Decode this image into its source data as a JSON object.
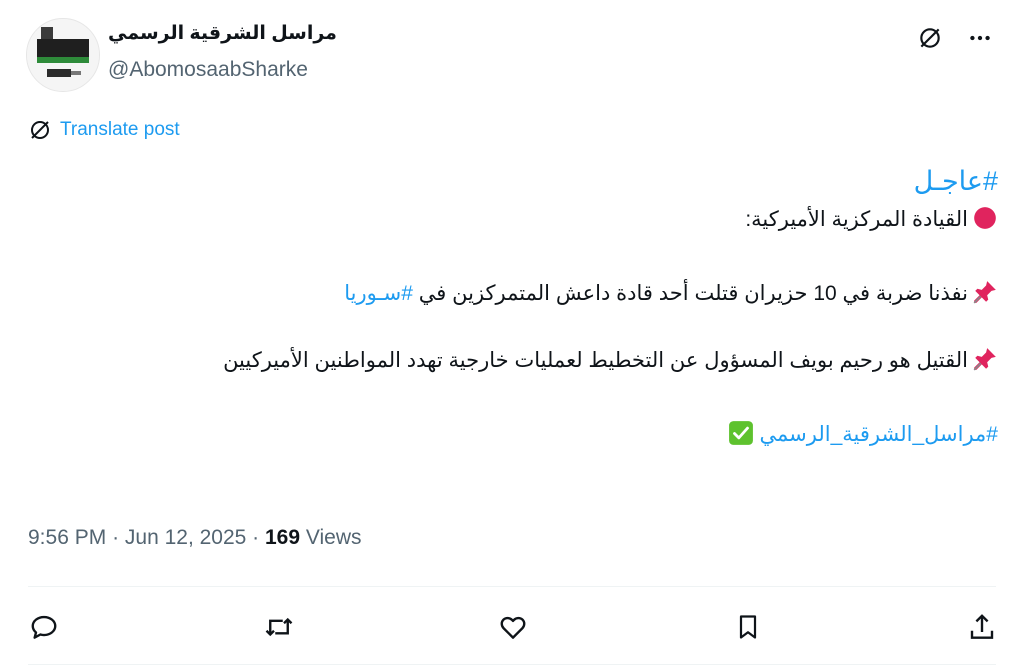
{
  "author": {
    "name": "مراسل الشرقية الرسمي",
    "handle": "@AbomosaabSharke"
  },
  "translate_label": "Translate post",
  "post": {
    "hashtag_title": "#عاجـل",
    "line1": "القيادة المركزية الأميركية:",
    "line2_text": "نفذنا ضربة في 10 حزيران قتلت أحد قادة داعش المتمركزين في",
    "line2_hashtag": "#سـوريا",
    "line3": "القتيل هو رحيم بويف المسؤول عن التخطيط لعمليات خارجية تهدد المواطنين الأميركيين",
    "footer_hashtag": "#مراسل_الشرقية_الرسمي"
  },
  "meta": {
    "time": "9:56 PM",
    "date": "Jun 12, 2025",
    "views_count": "169",
    "views_label": "Views"
  },
  "icons": {
    "grok": "no-sign-icon",
    "more": "more-icon",
    "reply": "reply-icon",
    "repost": "repost-icon",
    "like": "heart-icon",
    "bookmark": "bookmark-icon",
    "share": "share-icon"
  },
  "colors": {
    "accent": "#1d9bf0",
    "text": "#0f1419",
    "muted": "#536471",
    "red_dot": "#e0245e",
    "check_green": "#5ec22e"
  }
}
